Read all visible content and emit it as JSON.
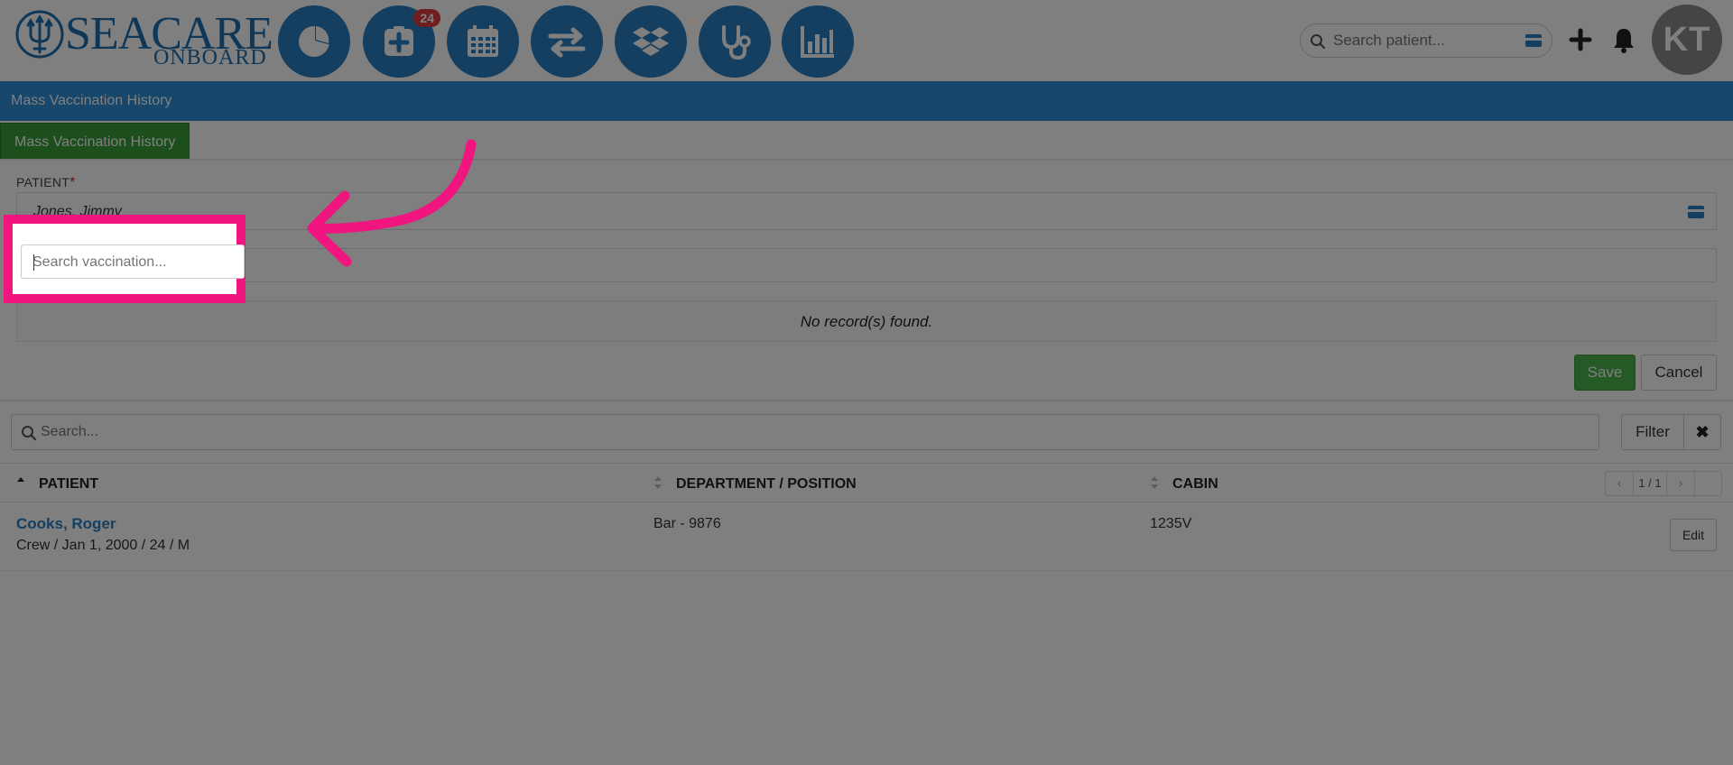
{
  "logo": {
    "word": "SEACARE",
    "sub": "ONBOARD"
  },
  "nav": {
    "badge_count": "24",
    "icons": [
      "dashboard-pie-icon",
      "medical-plus-icon",
      "calendar-icon",
      "transfer-arrows-icon",
      "dropbox-icon",
      "stethoscope-icon",
      "bar-chart-icon"
    ]
  },
  "topbar": {
    "search_placeholder": "Search patient...",
    "avatar_initials": "KT"
  },
  "page": {
    "header_title": "Mass Vaccination History",
    "tab_label": "Mass Vaccination History"
  },
  "form": {
    "patient_label": "PATIENT",
    "required_mark": "*",
    "patient_value": "Jones, Jimmy",
    "vaccination_placeholder": "Search vaccination...",
    "no_records": "No record(s) found.",
    "save_label": "Save",
    "cancel_label": "Cancel"
  },
  "list": {
    "search_placeholder": "Search...",
    "filter_label": "Filter",
    "clear_label": "✖",
    "columns": [
      "PATIENT",
      "DEPARTMENT / POSITION",
      "CABIN"
    ],
    "pager": {
      "prev": "‹",
      "page": "1 / 1",
      "next": "›"
    },
    "rows": [
      {
        "name": "Cooks, Roger",
        "details": "Crew / Jan 1, 2000 / 24 / M",
        "department": "Bar - 9876",
        "cabin": "1235V",
        "action": "Edit"
      }
    ]
  },
  "colors": {
    "brand_blue": "#2a7fc1",
    "header_blue": "#2f8fd5",
    "tab_green": "#3a9e3a",
    "save_green": "#4bb24b",
    "highlight_pink": "#f0157f"
  }
}
